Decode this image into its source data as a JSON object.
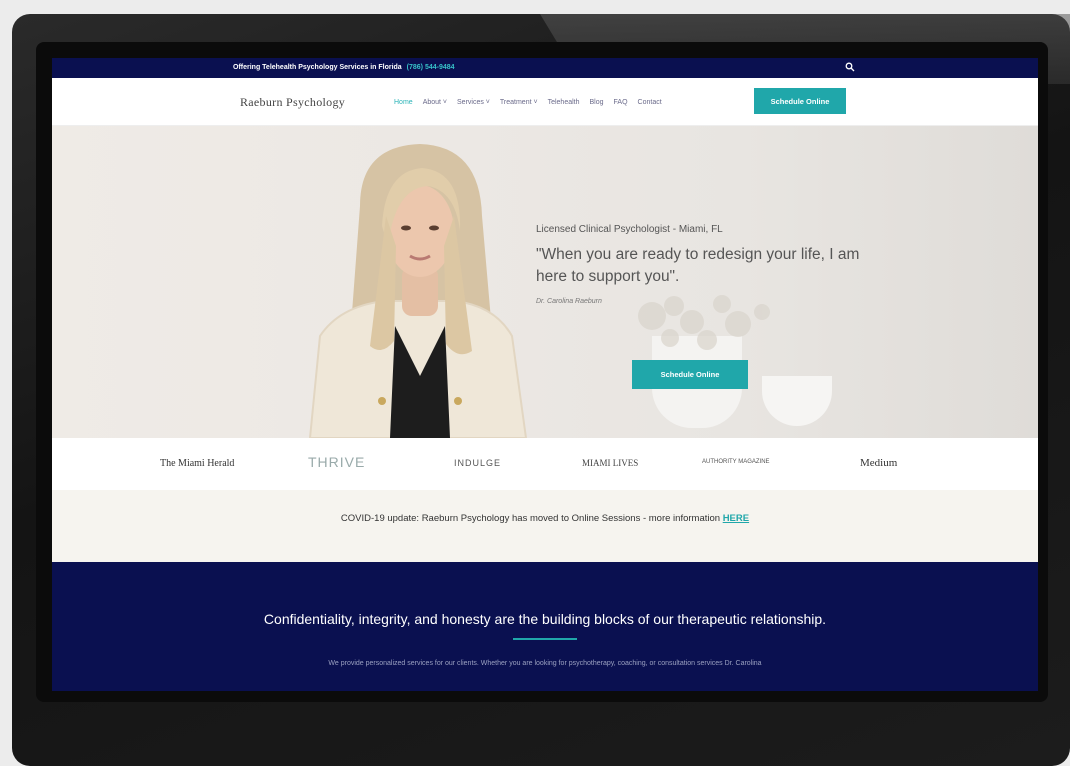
{
  "topbar": {
    "message": "Offering Telehealth Psychology Services in Florida",
    "phone": "(786) 544-9484",
    "search_icon": "search-icon"
  },
  "nav": {
    "logo": "Raeburn Psychology",
    "items": [
      "Home",
      "About ˅",
      "Services ˅",
      "Treatment ˅",
      "Telehealth",
      "Blog",
      "FAQ",
      "Contact"
    ],
    "cta": "Schedule Online",
    "accent": "#20a7aa"
  },
  "hero": {
    "subtitle": "Licensed Clinical Psychologist - Miami, FL",
    "quote": "\"When you are ready to redesign your life, I am here to support you\".",
    "signature": "Dr. Carolina Raeburn",
    "cta": "Schedule Online"
  },
  "press": [
    "The Miami Herald",
    "THRIVE",
    "INDULGE",
    "MIAMI LIVES",
    "AUTHORITY MAGAZINE",
    "Medium"
  ],
  "notice": {
    "text": "COVID-19 update: Raeburn Psychology has moved to Online Sessions - more information",
    "link": "HERE"
  },
  "values": {
    "heading": "Confidentiality, integrity, and honesty are the building blocks of our therapeutic relationship.",
    "body": "We provide personalized services for our clients. Whether you are looking for psychotherapy, coaching, or consultation services Dr. Carolina"
  },
  "colors": {
    "navy": "#0a1050",
    "teal": "#20a7aa"
  }
}
